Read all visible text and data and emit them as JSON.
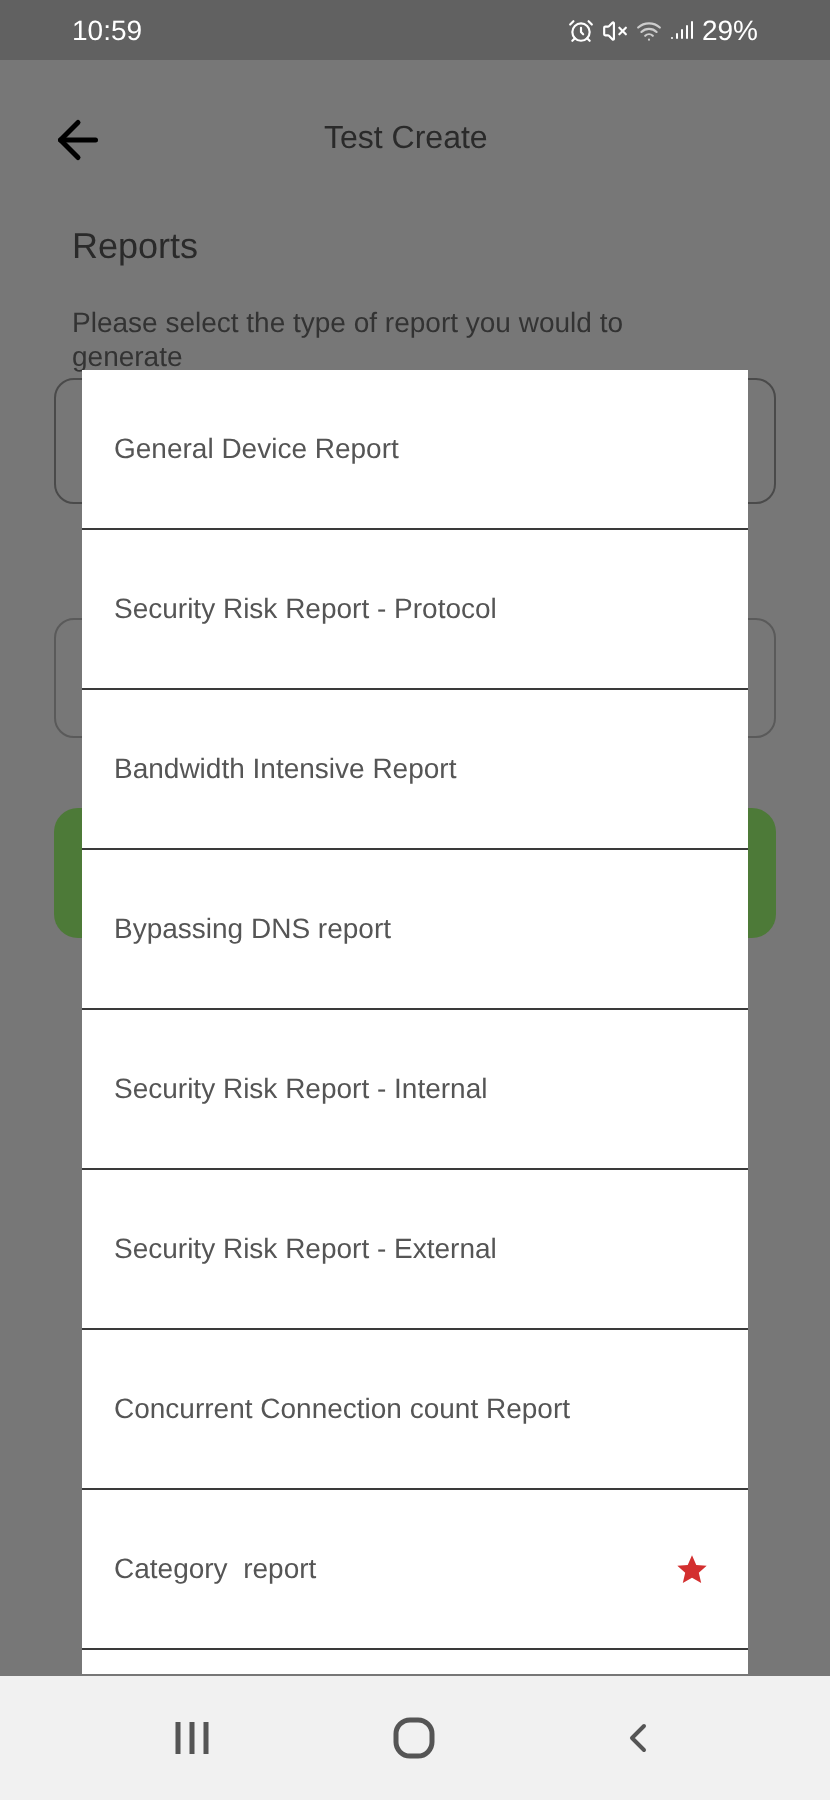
{
  "status_bar": {
    "time": "10:59",
    "battery": "29%"
  },
  "header": {
    "title": "Test Create"
  },
  "section": {
    "title": "Reports",
    "instruction": "Please select the type of report you would to generate"
  },
  "dialog": {
    "options": [
      {
        "label": "General Device Report",
        "starred": false
      },
      {
        "label": "Security Risk Report - Protocol",
        "starred": false
      },
      {
        "label": "Bandwidth Intensive Report",
        "starred": false
      },
      {
        "label": "Bypassing DNS report",
        "starred": false
      },
      {
        "label": "Security Risk Report - Internal",
        "starred": false
      },
      {
        "label": "Security Risk Report - External",
        "starred": false
      },
      {
        "label": "Concurrent Connection count Report",
        "starred": false
      },
      {
        "label": "Category  report",
        "starred": true
      }
    ]
  }
}
